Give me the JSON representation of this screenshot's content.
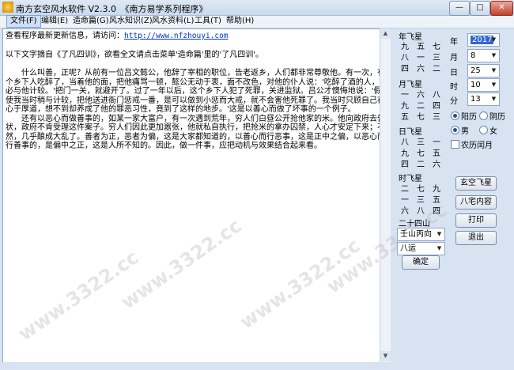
{
  "window": {
    "title": "南方玄空风水软件 V2.3.0　《南方易学系列程序》",
    "min": "—",
    "max": "□",
    "close": "✕"
  },
  "menu": [
    "文件(F)",
    "编辑(E)",
    "造命篇(G)",
    "风水知识(Z)",
    "风水资料(L)",
    "工具(T)",
    "帮助(H)"
  ],
  "content": {
    "update_line": "查看程序最新更新信息，请访问：",
    "update_url": "http://www.nfzhouyi.com",
    "intro": "以下文字摘自《了凡四训》，欲看全文请点击菜单'造命篇'里的'了凡四训'。",
    "para1": "　　什么叫善，正呢？从前有一位吕文懿公，他辞了宰相的职位，告老返乡，人们都非常尊敬他。有一次，有个乡下人吃醉了，当着他的面，把他痛骂一顿，懿公无动于衷，面不改色，对他的仆人说：'吃醉了酒的人，不必与他计较。'把门一关，就避开了。过了一年以后，这个乡下人犯了死罪，关进监狱。吕公才懊悔地说：'假使我当时稍与计较，把他送进衙门惩戒一番，是可以做到小惩而大戒，就不会害他死罪了。我当时只顾自己存心于厚道，想不到却养成了他的罪恶习性，竟到了这样的地步。'这是以善心而做了坏事的一个例子。",
    "para2": "　　还有以恶心而做善事的，如某一家大富户，有一次遇到荒年，穷人们白昼公开抢他家的米。他向政府去告状，政府不肯受理这件案子。穷人们因此更加嚣张，他就私自执行，把抢米的拿办囚禁，人心才安定下来；不然，几乎酿成大乱了。善者为正，恶者为偏，这是大家都知道的，以善心而行恶事，这是正中之偏，以恶心而行善事的，是偏中之正，这是人所不知的。因此，做一件事，应把动机与效果结合起来看。"
  },
  "watermark": "www.3322.cc",
  "right_panel": {
    "year_star": {
      "label": "年飞星",
      "grid": [
        "九",
        "五",
        "七",
        "八",
        "一",
        "三",
        "四",
        "六",
        "二"
      ]
    },
    "month_star": {
      "label": "月飞星",
      "grid": [
        "一",
        "六",
        "八",
        "九",
        "二",
        "四",
        "五",
        "七",
        "三"
      ]
    },
    "day_star": {
      "label": "日飞星",
      "grid": [
        "八",
        "三",
        "一",
        "九",
        "七",
        "五",
        "四",
        "二",
        "六"
      ]
    },
    "hour_star": {
      "label": "时飞星",
      "grid": [
        "二",
        "七",
        "九",
        "一",
        "三",
        "五",
        "六",
        "八",
        "四"
      ]
    },
    "mountains_label": "二十四山",
    "mountain_value": "壬山丙向",
    "yun_value": "八运",
    "confirm_button": "确定",
    "year_label": "年",
    "year_value": "2017",
    "month_label": "月",
    "month_value": "8",
    "day_label": "日",
    "day_value": "25",
    "hour_label": "时",
    "hour_value": "10",
    "minute_label": "分",
    "minute_value": "13",
    "solar_label": "阳历",
    "lunar_label": "阴历",
    "male_label": "男",
    "female_label": "女",
    "leap_label": "农历闰月",
    "btn_xuankong": "玄空飞星",
    "btn_bazhai": "八宅内容",
    "btn_print": "打印",
    "btn_exit": "退出"
  }
}
